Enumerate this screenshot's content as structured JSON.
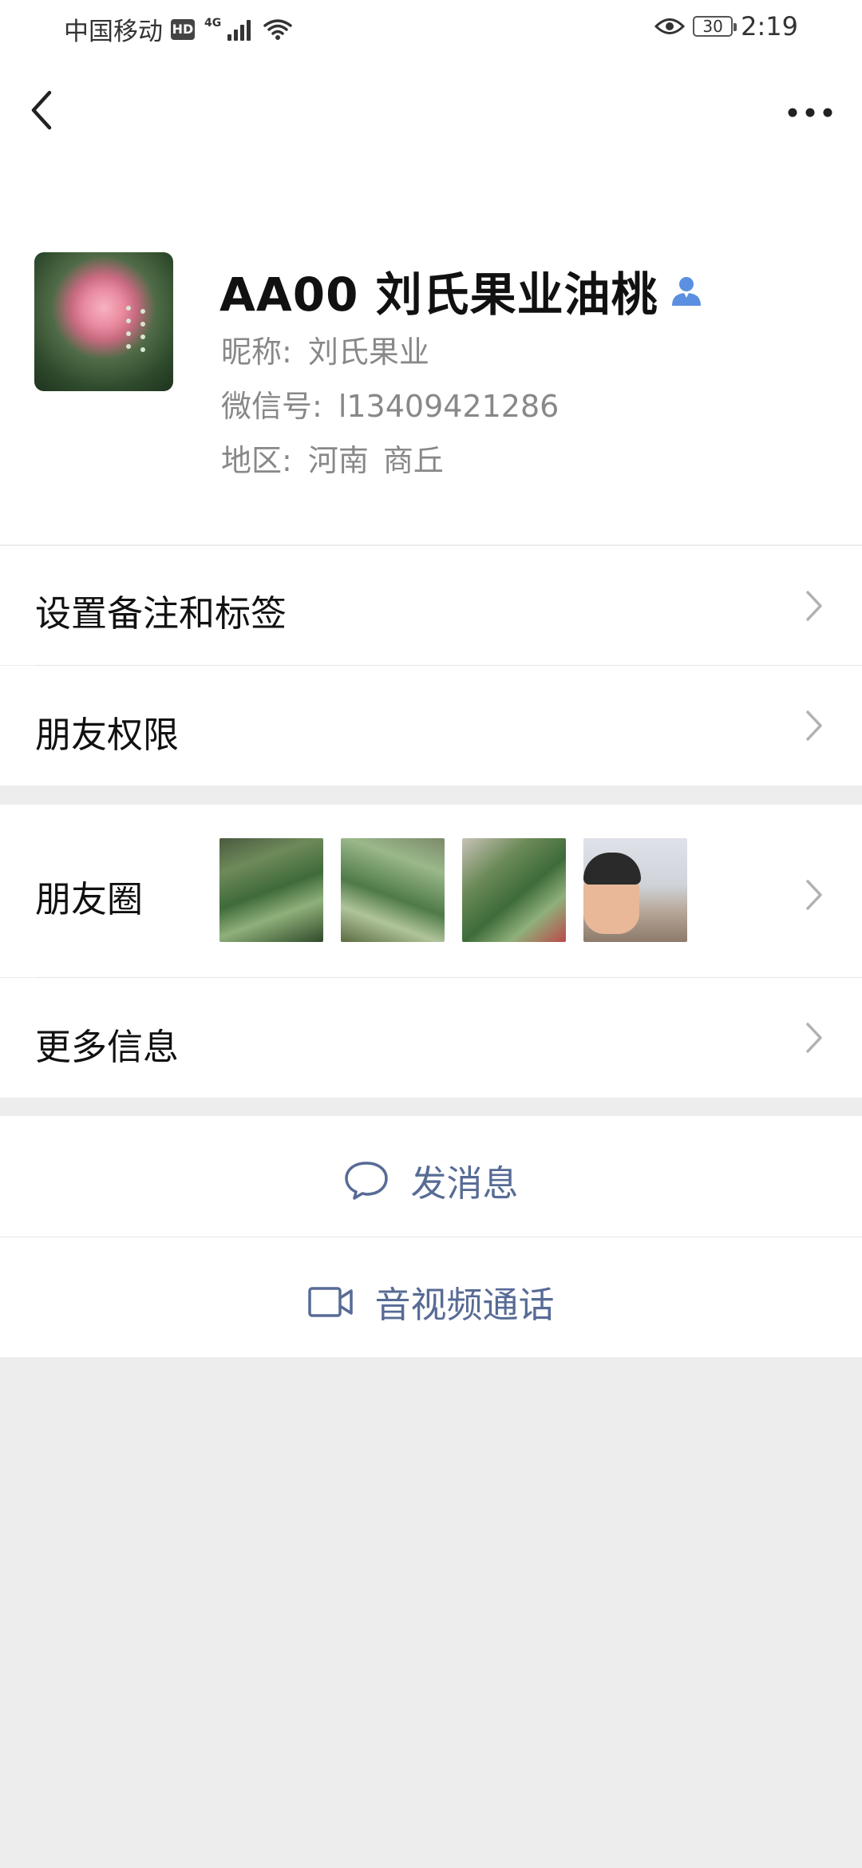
{
  "status_bar": {
    "carrier": "中国移动",
    "hd_badge": "HD",
    "network": "4G",
    "battery": "30",
    "time": "2:19"
  },
  "nav": {
    "back_icon": "chevron-left-icon",
    "more_icon": "more-horizontal-icon"
  },
  "profile": {
    "display_name": "AA00 刘氏果业油桃",
    "nickname_label": "昵称:",
    "nickname": "刘氏果业",
    "wechat_id_label": "微信号:",
    "wechat_id": "l13409421286",
    "region_label": "地区:",
    "region_province": "河南",
    "region_city": "商丘",
    "contact_icon": "person-icon"
  },
  "rows": {
    "remark_tags": "设置备注和标签",
    "friend_permissions": "朋友权限",
    "moments": "朋友圈",
    "more_info": "更多信息"
  },
  "actions": {
    "send_message": "发消息",
    "video_call": "音视频通话"
  },
  "colors": {
    "link_blue": "#576b95",
    "background": "#ededed",
    "surface": "#ffffff"
  }
}
